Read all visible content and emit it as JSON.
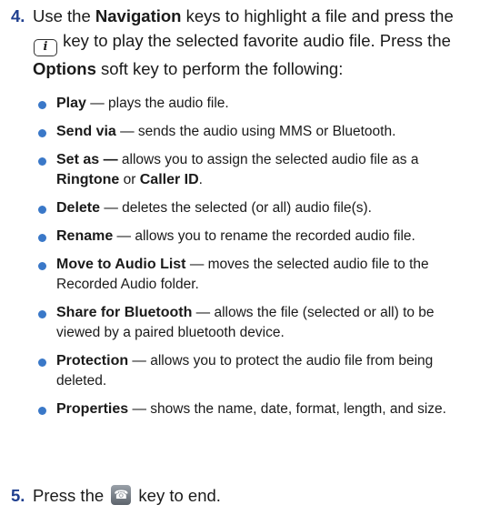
{
  "colors": {
    "bullet": "#3a78c8",
    "step_number": "#1f3f8f"
  },
  "step4": {
    "number": "4.",
    "t1": "Use the ",
    "nav": "Navigation",
    "t2": " keys to highlight a file and press the ",
    "key_icon_glyph": "i",
    "t3": " key to play the selected favorite audio file. Press the ",
    "options": "Options",
    "t4": " soft key to perform the following:"
  },
  "options": [
    {
      "term": "Play",
      "desc": " — plays the audio file."
    },
    {
      "term": "Send via",
      "desc": " — sends the audio using MMS or Bluetooth."
    },
    {
      "term": "Set as —",
      "desc": " allows you to assign the selected audio file as a ",
      "term2": "Ringtone",
      "mid": " or ",
      "term3": "Caller ID",
      "end": "."
    },
    {
      "term": "Delete",
      "desc": " — deletes the selected (or all) audio file(s)."
    },
    {
      "term": "Rename",
      "desc": " — allows you to rename the recorded audio file."
    },
    {
      "term": "Move to Audio List",
      "desc": " — moves the selected audio file to the Recorded Audio folder."
    },
    {
      "term": "Share for Bluetooth",
      "desc": " — allows the file (selected or all) to be viewed by a paired bluetooth device."
    },
    {
      "term": "Protection",
      "desc": " — allows you to protect the audio file from being deleted."
    },
    {
      "term": "Properties",
      "desc": " — shows the name, date, format, length, and size."
    }
  ],
  "step5": {
    "number": "5.",
    "t1": "Press the ",
    "end_icon_glyph": "☎",
    "t2": " key to end."
  }
}
